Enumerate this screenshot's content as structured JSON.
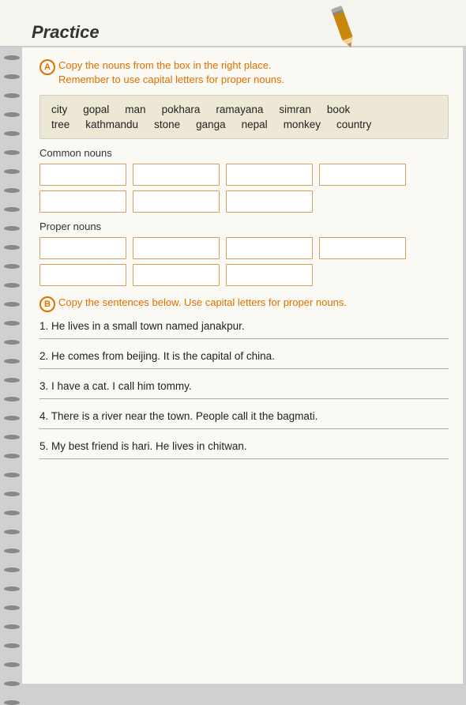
{
  "page": {
    "title": "Practice"
  },
  "sectionA": {
    "circle": "A",
    "instruction_line1": "Copy the nouns from the box in the right place.",
    "instruction_line2": "Remember to use capital letters for proper nouns.",
    "words_row1": [
      "city",
      "gopal",
      "man",
      "pokhara",
      "ramayana",
      "simran",
      "book"
    ],
    "words_row2": [
      "tree",
      "kathmandu",
      "stone",
      "ganga",
      "nepal",
      "monkey",
      "country"
    ],
    "common_nouns_label": "Common nouns",
    "proper_nouns_label": "Proper nouns"
  },
  "sectionB": {
    "circle": "B",
    "instruction": "Copy the sentences below. Use capital letters for proper nouns.",
    "sentences": [
      "1. He lives in a small town named janakpur.",
      "2. He comes from beijing. It is the capital of china.",
      "3. I have a cat. I call him tommy.",
      "4. There is a river near the town. People call it the bagmati.",
      "5. My best friend is hari. He lives in chitwan."
    ]
  }
}
